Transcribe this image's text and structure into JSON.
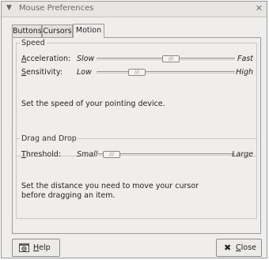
{
  "window": {
    "title": "Mouse Preferences",
    "menu_icon": "chevron-down-icon",
    "close_icon": "close-icon"
  },
  "tabs": [
    {
      "label": "Buttons",
      "active": false
    },
    {
      "label": "Cursors",
      "active": false
    },
    {
      "label": "Motion",
      "active": true
    }
  ],
  "speed": {
    "title": "Speed",
    "acceleration": {
      "label_mnemonic": "A",
      "label_rest": "cceleration:",
      "low": "Slow",
      "high": "Fast",
      "value_fraction": 0.54
    },
    "sensitivity": {
      "label_mnemonic": "S",
      "label_rest": "ensitivity:",
      "low": "Low",
      "high": "High",
      "value_fraction": 0.26
    },
    "description": "Set the speed of your pointing device."
  },
  "drag": {
    "title": "Drag and Drop",
    "threshold": {
      "label_mnemonic": "T",
      "label_rest": "hreshold:",
      "low": "Small",
      "high": "Large",
      "value_fraction": 0.05
    },
    "description_line1": "Set the distance you need to move your cursor",
    "description_line2": "before dragging an item."
  },
  "buttons": {
    "help_label": "Help",
    "help_icon": "help-icon",
    "close_label": "Close",
    "close_icon": "close-icon"
  }
}
